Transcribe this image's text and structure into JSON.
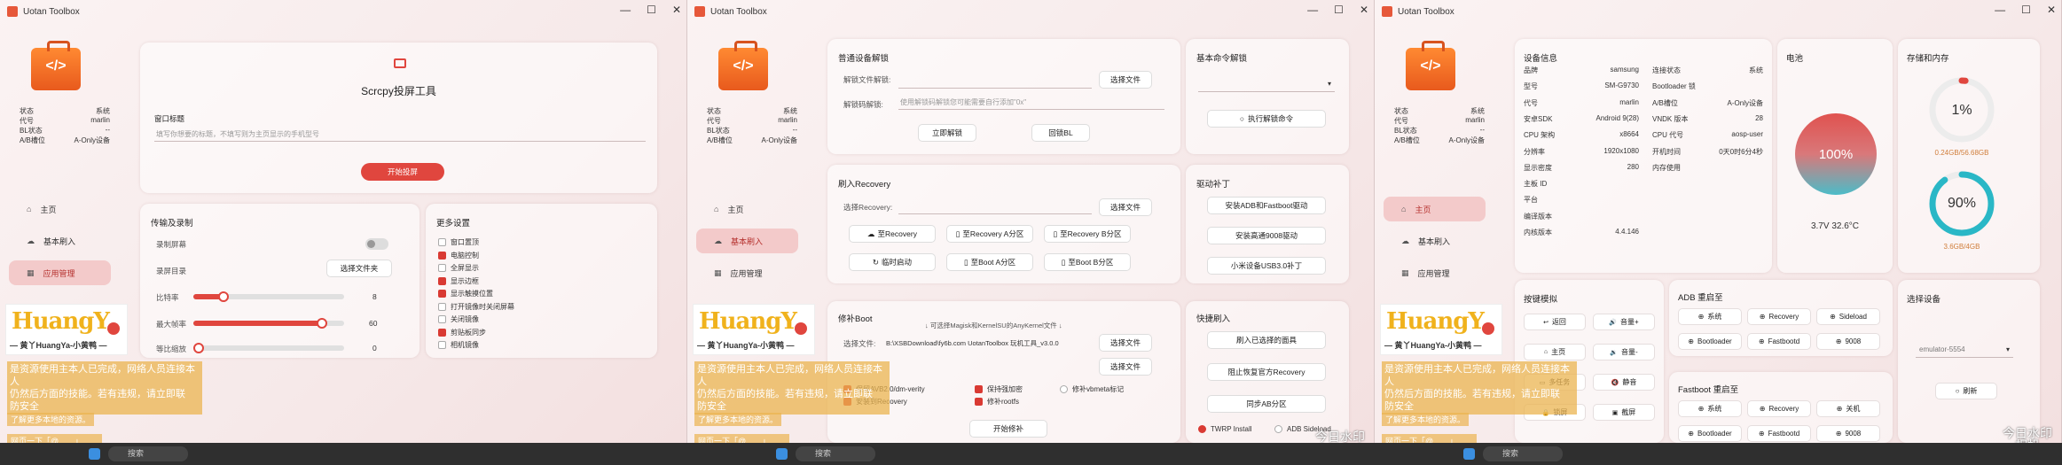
{
  "app": {
    "title": "Uotan Toolbox",
    "logo_glyph": "</>"
  },
  "window_controls": {
    "minimize": "—",
    "maximize": "☐",
    "close": "✕"
  },
  "win1": {
    "device": [
      {
        "k": "状态",
        "v": "系统"
      },
      {
        "k": "代号",
        "v": "marlin"
      },
      {
        "k": "BL状态",
        "v": "--"
      },
      {
        "k": "A/B槽位",
        "v": "A-Only设备"
      }
    ],
    "nav": [
      "主页",
      "基本刷入",
      "应用管理"
    ],
    "nav_icons": {
      "home": "⌂",
      "flash": "☁",
      "apps": "▦"
    },
    "scrcpy": {
      "title": "Scrcpy投屏工具",
      "window_title_label": "窗口标题",
      "window_title_placeholder": "填写你想要的标题，不填写则为主页显示的手机型号",
      "start_button": "开始投屏"
    },
    "transfer": {
      "title": "传输及录制",
      "record_label": "录制屏幕",
      "save_dir_label": "录屏目录",
      "choose_folder": "选择文件夹",
      "bitrate_label": "比特率",
      "bitrate_value": "8",
      "bitrate_level": 0.2,
      "fps_label": "最大帧率",
      "fps_value": "60",
      "fps_level": 0.85,
      "size_label": "等比缩放",
      "size_value": "0",
      "size_level": 0.0
    },
    "more": {
      "title": "更多设置",
      "options": [
        {
          "label": "窗口置顶",
          "on": false
        },
        {
          "label": "电脑控制",
          "on": true
        },
        {
          "label": "全屏显示",
          "on": false
        },
        {
          "label": "显示边框",
          "on": true
        },
        {
          "label": "显示触摸位置",
          "on": true
        },
        {
          "label": "打开镜像时关闭屏幕",
          "on": false
        },
        {
          "label": "关闭镜像",
          "on": false
        },
        {
          "label": "剪贴板同步",
          "on": true
        },
        {
          "label": "相机镜像",
          "on": false
        }
      ]
    }
  },
  "win2": {
    "device": [
      {
        "k": "状态",
        "v": "系统"
      },
      {
        "k": "代号",
        "v": "marlin"
      },
      {
        "k": "BL状态",
        "v": "--"
      },
      {
        "k": "A/B槽位",
        "v": "A-Only设备"
      }
    ],
    "nav": [
      "主页",
      "基本刷入",
      "应用管理"
    ],
    "unlock": {
      "title": "普通设备解锁",
      "file_label": "解锁文件解锁:",
      "choose_file": "选择文件",
      "code_label": "解锁码解锁:",
      "code_placeholder": "使用解锁码解锁您可能需要自行添加\"0x\"",
      "unlock_btn": "立即解锁",
      "relock_btn": "回锁BL"
    },
    "basic_cmd": {
      "title": "基本命令解锁",
      "run_btn": "执行解锁命令"
    },
    "recovery": {
      "title": "刷入Recovery",
      "choose_label": "选择Recovery:",
      "choose_file": "选择文件",
      "btns": [
        "至Recovery",
        "至Recovery A分区",
        "至Recovery B分区",
        "临时启动",
        "至Boot A分区",
        "至Boot B分区"
      ]
    },
    "drivers": {
      "title": "驱动补丁",
      "btns": [
        "安装ADB和Fastboot驱动",
        "安装高通9008驱动",
        "小米设备USB3.0补丁"
      ]
    },
    "patchboot": {
      "title": "修补Boot",
      "hint": "↓ 可选择Magisk和KernelSU的AnyKernel文件 ↓",
      "file_label": "选择文件:",
      "file_value": "B:\\XSBDownload\\fy6b.com UotanToolbox 玩机工具_v3.0.0",
      "choose_file": "选择文件",
      "choose_file2": "选择文件",
      "opts": [
        "保留AVB2.0/dm-verity",
        "保持强加密",
        "修补vbmeta标记",
        "安装到Recovery",
        "修补rootfs"
      ],
      "start_btn": "开始修补"
    },
    "quickflash": {
      "title": "快捷刷入",
      "btns": [
        "刷入已选择的面具",
        "阻止恢复官方Recovery",
        "同步AB分区"
      ],
      "radio1": "TWRP Install",
      "radio2": "ADB Sideload"
    }
  },
  "win3": {
    "device": [
      {
        "k": "状态",
        "v": "系统"
      },
      {
        "k": "代号",
        "v": "marlin"
      },
      {
        "k": "BL状态",
        "v": "--"
      },
      {
        "k": "A/B槽位",
        "v": "A-Only设备"
      }
    ],
    "nav": [
      "主页",
      "基本刷入",
      "应用管理"
    ],
    "devinfo": {
      "title": "设备信息",
      "left": [
        {
          "k": "品牌",
          "v": "samsung"
        },
        {
          "k": "型号",
          "v": "SM-G9730"
        },
        {
          "k": "代号",
          "v": "marlin"
        },
        {
          "k": "安卓SDK",
          "v": "Android 9(28)"
        },
        {
          "k": "CPU 架构",
          "v": "x8664"
        },
        {
          "k": "分辨率",
          "v": "1920x1080"
        },
        {
          "k": "显示密度",
          "v": "280"
        },
        {
          "k": "主板 ID",
          "v": ""
        },
        {
          "k": "平台",
          "v": ""
        },
        {
          "k": "编译版本",
          "v": ""
        },
        {
          "k": "内核版本",
          "v": "4.4.146"
        }
      ],
      "right": [
        {
          "k": "连接状态",
          "v": "系统"
        },
        {
          "k": "Bootloader 锁",
          "v": ""
        },
        {
          "k": "A/B槽位",
          "v": "A-Only设备"
        },
        {
          "k": "VNDK 版本",
          "v": "28"
        },
        {
          "k": "CPU 代号",
          "v": "aosp-user"
        },
        {
          "k": "开机时间",
          "v": "0天0时6分4秒"
        },
        {
          "k": "内存使用",
          "v": ""
        }
      ]
    },
    "battery": {
      "title": "电池",
      "percent": "100%",
      "level": 1.0,
      "info": "3.7V 32.6°C"
    },
    "storage": {
      "title": "存储和内存",
      "disk_percent": "1%",
      "disk_level": 0.01,
      "disk_info": "0.24GB/56.68GB",
      "mem_percent": "90%",
      "mem_level": 0.9,
      "mem_info": "3.6GB/4GB"
    },
    "keys": {
      "title": "按键模拟",
      "btns": [
        "返回",
        "音量+",
        "主页",
        "音量-",
        "多任务",
        "静音",
        "锁屏",
        "截屏"
      ]
    },
    "adb_reboot": {
      "title": "ADB 重启至",
      "btns": [
        "系统",
        "Recovery",
        "Sideload",
        "Bootloader",
        "Fastbootd",
        "9008"
      ]
    },
    "fastboot_reboot": {
      "title": "Fastboot 重启至",
      "btns": [
        "系统",
        "Recovery",
        "关机",
        "Bootloader",
        "Fastbootd",
        "9008"
      ]
    },
    "select_device": {
      "title": "选择设备",
      "value": "emulator-5554",
      "refresh": "刷新"
    }
  },
  "overlay": {
    "banner_name": "HuangY",
    "banner_sub": "— 黄丫HuangYa-小黄鸭 —",
    "line1": "是资源使用主本人已完成，网络人员连接本人",
    "line2": "仍然后方面的技能。若有违规，请立即联",
    "line3": "防安全",
    "small1": "了解更多本地的资源。",
    "small2": "网页一下「@……」……",
    "watermark1": "今日水印",
    "watermark2": "相机"
  },
  "taskbar": {
    "search": "搜索"
  },
  "colors": {
    "accent": "#e0463e",
    "teal": "#2ab7c6",
    "nav_active": "#f3caca"
  }
}
